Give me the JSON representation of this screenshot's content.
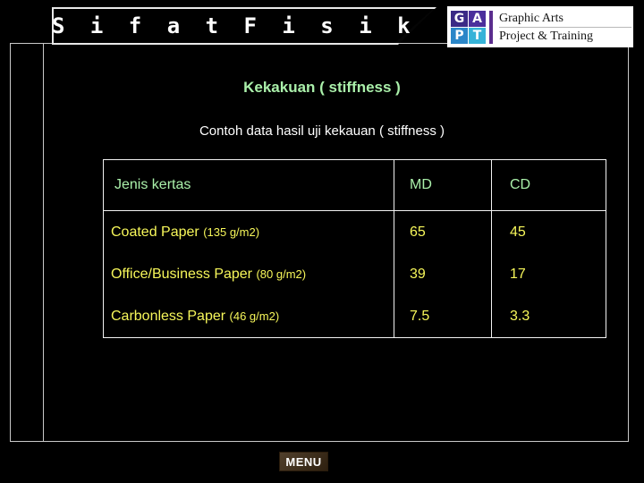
{
  "banner": {
    "title": "S i f a t   F i s i k"
  },
  "logo": {
    "mark_letters": [
      "G",
      "A",
      "P",
      "T"
    ],
    "line1": "Graphic Arts",
    "line2": "Project & Training",
    "colors": {
      "g_box": "#3b2a86",
      "a_box": "#4b2f9c",
      "p_box": "#2a86c8",
      "t_box": "#36b3d8",
      "rule": "#5b2d8e"
    }
  },
  "content": {
    "heading": "Kekakuan ( stiffness )",
    "heading_color": "#aaf0aa",
    "subheading": "Contoh data hasil uji kekauan ( stiffness )",
    "subheading_color": "#ffffff"
  },
  "table": {
    "header_color": "#aaf0aa",
    "body_color": "#f7f75a",
    "border_color": "#f2f2f2",
    "columns": [
      "Jenis kertas",
      "MD",
      "CD"
    ],
    "rows": [
      {
        "name": "Coated Paper",
        "gsm": "(135 g/m2)",
        "md": "65",
        "cd": "45"
      },
      {
        "name": "Office/Business Paper",
        "gsm": "(80 g/m2)",
        "md": "39",
        "cd": "17"
      },
      {
        "name": "Carbonless Paper",
        "gsm": "(46 g/m2)",
        "md": "7.5",
        "cd": "3.3"
      }
    ]
  },
  "footer": {
    "menu_label": "MENU"
  }
}
